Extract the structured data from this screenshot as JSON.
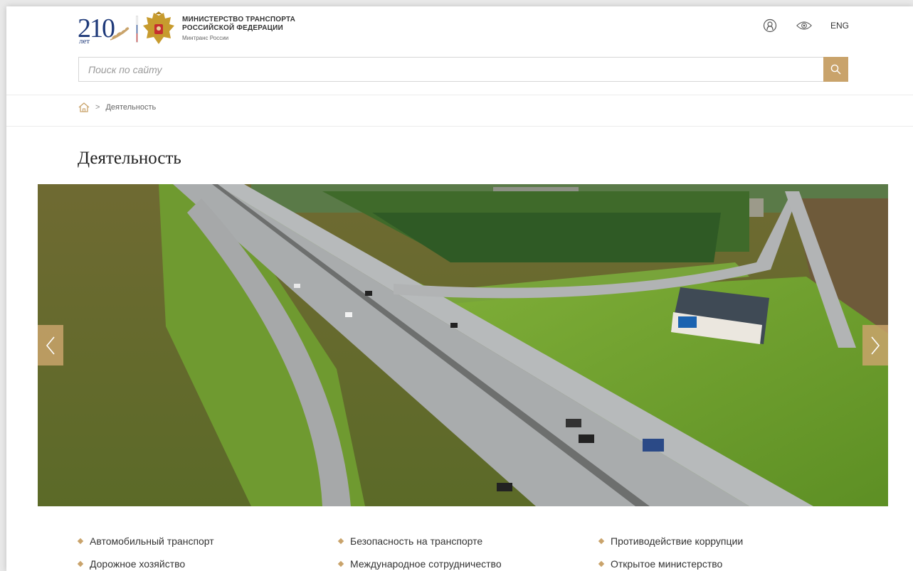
{
  "header": {
    "anniversary_number": "210",
    "anniversary_suffix": "лет",
    "ministry_line1": "МИНИСТЕРСТВО ТРАНСПОРТА",
    "ministry_line2": "РОССИЙСКОЙ ФЕДЕРАЦИИ",
    "ministry_short": "Минтранс России",
    "icons": [
      "user-icon",
      "eye-icon"
    ],
    "lang_label": "ENG"
  },
  "search": {
    "placeholder": "Поиск по сайту",
    "button_icon": "search-icon"
  },
  "breadcrumb": {
    "home_icon": "home-icon",
    "separator": ">",
    "current": "Деятельность"
  },
  "page_title": "Деятельность",
  "slider": {
    "prev_icon": "chevron-left-icon",
    "next_icon": "chevron-right-icon"
  },
  "links": [
    {
      "label": "Автомобильный транспорт"
    },
    {
      "label": "Безопасность на транспорте"
    },
    {
      "label": "Противодействие коррупции"
    },
    {
      "label": "Дорожное хозяйство"
    },
    {
      "label": "Международное сотрудничество"
    },
    {
      "label": "Открытое министерство"
    }
  ],
  "colors": {
    "accent": "#c9a36b",
    "brand_blue": "#1f3a7a"
  }
}
